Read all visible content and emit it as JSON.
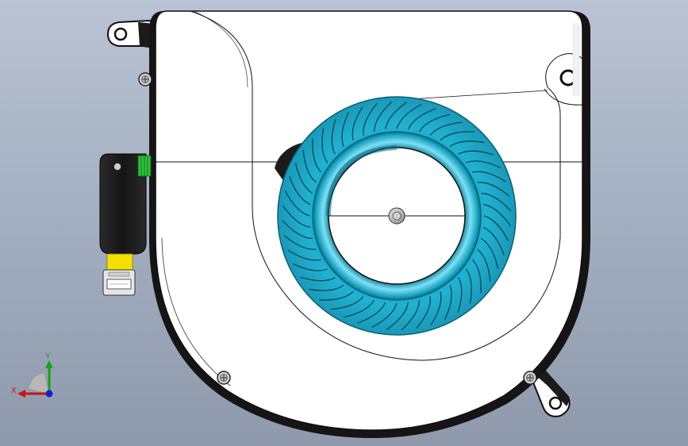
{
  "viewport": {
    "background_top": "#b9c3d3",
    "background_bottom": "#8e99ac"
  },
  "model": {
    "housing_color": "#ffffff",
    "outline_color": "#111111",
    "impeller_color": "#1aa6c4",
    "impeller_highlight": "#7fdcef",
    "cable_color": "#1c1c1c",
    "connector_tape_color": "#f5df00",
    "flex_stripe_color": "#2fbf3a"
  },
  "triad": {
    "x_label": "X",
    "y_label": "Y",
    "x_color": "#d01010",
    "y_color": "#1aa01a",
    "z_color": "#1020d0"
  }
}
